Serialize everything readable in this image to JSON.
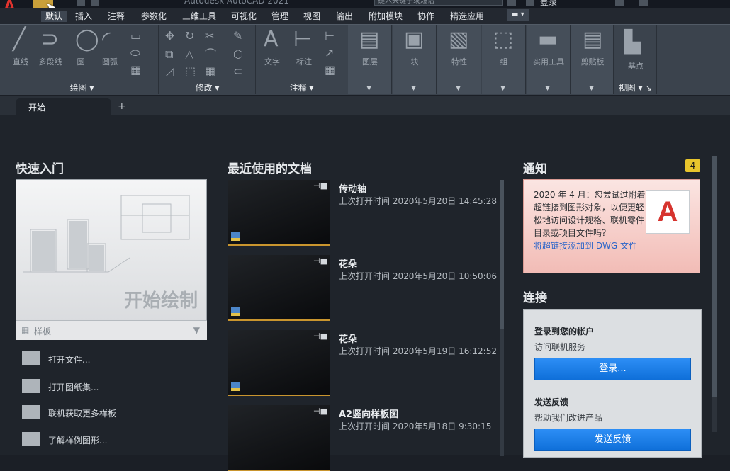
{
  "app": {
    "title": "Autodesk AutoCAD 2021",
    "search_placeholder": "键入关键字或短语",
    "login": "登录"
  },
  "ribbon_tabs": [
    "默认",
    "插入",
    "注释",
    "参数化",
    "三维工具",
    "可视化",
    "管理",
    "视图",
    "输出",
    "附加模块",
    "协作",
    "精选应用"
  ],
  "ribbon": {
    "draw": {
      "label": "绘图",
      "tools": [
        "直线",
        "多段线",
        "圆",
        "圆弧"
      ]
    },
    "modify": {
      "label": "修改"
    },
    "annotation": {
      "label": "注释",
      "tools": [
        "文字",
        "标注"
      ]
    },
    "layers": "图层",
    "block": "块",
    "properties": "特性",
    "groups": "组",
    "utilities": "实用工具",
    "clipboard": "剪贴板",
    "view": {
      "label": "视图",
      "tools": [
        "基点"
      ]
    }
  },
  "doc_tab": {
    "label": "开始",
    "plus": "+"
  },
  "quick_start": {
    "heading": "快速入门",
    "card_title": "开始绘制",
    "template_label": "样板",
    "links": [
      "打开文件...",
      "打开图纸集...",
      "联机获取更多样板",
      "了解样例图形..."
    ]
  },
  "recent": {
    "heading": "最近使用的文档",
    "items": [
      {
        "name": "传动轴",
        "time": "上次打开时间 2020年5月20日 14:45:28"
      },
      {
        "name": "花朵",
        "time": "上次打开时间 2020年5月20日 10:50:06"
      },
      {
        "name": "花朵",
        "time": "上次打开时间 2020年5月19日 16:12:52"
      },
      {
        "name": "A2竖向样板图",
        "time": "上次打开时间 2020年5月18日 9:30:15"
      }
    ]
  },
  "notice": {
    "heading": "通知",
    "count": "4",
    "message": "2020 年 4 月：您尝试过附着超链接到图形对象，以便更轻松地访问设计规格、联机零件目录或项目文件吗？",
    "link": "将超链接添加到 DWG 文件"
  },
  "connect": {
    "heading": "连接",
    "login_title": "登录到您的帐户",
    "login_sub": "访问联机服务",
    "login_button": "登录...",
    "feedback_title": "发送反馈",
    "feedback_sub": "帮助我们改进产品",
    "feedback_button": "发送反馈"
  },
  "colors": {
    "accent_button": "#1a7ee8",
    "badge": "#e8c52c",
    "logo": "#e0332e"
  }
}
